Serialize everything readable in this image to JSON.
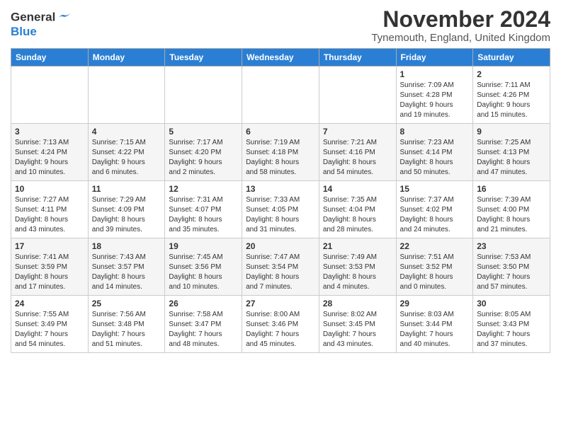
{
  "header": {
    "logo_line1": "General",
    "logo_line2": "Blue",
    "month_title": "November 2024",
    "location": "Tynemouth, England, United Kingdom"
  },
  "weekdays": [
    "Sunday",
    "Monday",
    "Tuesday",
    "Wednesday",
    "Thursday",
    "Friday",
    "Saturday"
  ],
  "weeks": [
    [
      {
        "day": "",
        "info": ""
      },
      {
        "day": "",
        "info": ""
      },
      {
        "day": "",
        "info": ""
      },
      {
        "day": "",
        "info": ""
      },
      {
        "day": "",
        "info": ""
      },
      {
        "day": "1",
        "info": "Sunrise: 7:09 AM\nSunset: 4:28 PM\nDaylight: 9 hours\nand 19 minutes."
      },
      {
        "day": "2",
        "info": "Sunrise: 7:11 AM\nSunset: 4:26 PM\nDaylight: 9 hours\nand 15 minutes."
      }
    ],
    [
      {
        "day": "3",
        "info": "Sunrise: 7:13 AM\nSunset: 4:24 PM\nDaylight: 9 hours\nand 10 minutes."
      },
      {
        "day": "4",
        "info": "Sunrise: 7:15 AM\nSunset: 4:22 PM\nDaylight: 9 hours\nand 6 minutes."
      },
      {
        "day": "5",
        "info": "Sunrise: 7:17 AM\nSunset: 4:20 PM\nDaylight: 9 hours\nand 2 minutes."
      },
      {
        "day": "6",
        "info": "Sunrise: 7:19 AM\nSunset: 4:18 PM\nDaylight: 8 hours\nand 58 minutes."
      },
      {
        "day": "7",
        "info": "Sunrise: 7:21 AM\nSunset: 4:16 PM\nDaylight: 8 hours\nand 54 minutes."
      },
      {
        "day": "8",
        "info": "Sunrise: 7:23 AM\nSunset: 4:14 PM\nDaylight: 8 hours\nand 50 minutes."
      },
      {
        "day": "9",
        "info": "Sunrise: 7:25 AM\nSunset: 4:13 PM\nDaylight: 8 hours\nand 47 minutes."
      }
    ],
    [
      {
        "day": "10",
        "info": "Sunrise: 7:27 AM\nSunset: 4:11 PM\nDaylight: 8 hours\nand 43 minutes."
      },
      {
        "day": "11",
        "info": "Sunrise: 7:29 AM\nSunset: 4:09 PM\nDaylight: 8 hours\nand 39 minutes."
      },
      {
        "day": "12",
        "info": "Sunrise: 7:31 AM\nSunset: 4:07 PM\nDaylight: 8 hours\nand 35 minutes."
      },
      {
        "day": "13",
        "info": "Sunrise: 7:33 AM\nSunset: 4:05 PM\nDaylight: 8 hours\nand 31 minutes."
      },
      {
        "day": "14",
        "info": "Sunrise: 7:35 AM\nSunset: 4:04 PM\nDaylight: 8 hours\nand 28 minutes."
      },
      {
        "day": "15",
        "info": "Sunrise: 7:37 AM\nSunset: 4:02 PM\nDaylight: 8 hours\nand 24 minutes."
      },
      {
        "day": "16",
        "info": "Sunrise: 7:39 AM\nSunset: 4:00 PM\nDaylight: 8 hours\nand 21 minutes."
      }
    ],
    [
      {
        "day": "17",
        "info": "Sunrise: 7:41 AM\nSunset: 3:59 PM\nDaylight: 8 hours\nand 17 minutes."
      },
      {
        "day": "18",
        "info": "Sunrise: 7:43 AM\nSunset: 3:57 PM\nDaylight: 8 hours\nand 14 minutes."
      },
      {
        "day": "19",
        "info": "Sunrise: 7:45 AM\nSunset: 3:56 PM\nDaylight: 8 hours\nand 10 minutes."
      },
      {
        "day": "20",
        "info": "Sunrise: 7:47 AM\nSunset: 3:54 PM\nDaylight: 8 hours\nand 7 minutes."
      },
      {
        "day": "21",
        "info": "Sunrise: 7:49 AM\nSunset: 3:53 PM\nDaylight: 8 hours\nand 4 minutes."
      },
      {
        "day": "22",
        "info": "Sunrise: 7:51 AM\nSunset: 3:52 PM\nDaylight: 8 hours\nand 0 minutes."
      },
      {
        "day": "23",
        "info": "Sunrise: 7:53 AM\nSunset: 3:50 PM\nDaylight: 7 hours\nand 57 minutes."
      }
    ],
    [
      {
        "day": "24",
        "info": "Sunrise: 7:55 AM\nSunset: 3:49 PM\nDaylight: 7 hours\nand 54 minutes."
      },
      {
        "day": "25",
        "info": "Sunrise: 7:56 AM\nSunset: 3:48 PM\nDaylight: 7 hours\nand 51 minutes."
      },
      {
        "day": "26",
        "info": "Sunrise: 7:58 AM\nSunset: 3:47 PM\nDaylight: 7 hours\nand 48 minutes."
      },
      {
        "day": "27",
        "info": "Sunrise: 8:00 AM\nSunset: 3:46 PM\nDaylight: 7 hours\nand 45 minutes."
      },
      {
        "day": "28",
        "info": "Sunrise: 8:02 AM\nSunset: 3:45 PM\nDaylight: 7 hours\nand 43 minutes."
      },
      {
        "day": "29",
        "info": "Sunrise: 8:03 AM\nSunset: 3:44 PM\nDaylight: 7 hours\nand 40 minutes."
      },
      {
        "day": "30",
        "info": "Sunrise: 8:05 AM\nSunset: 3:43 PM\nDaylight: 7 hours\nand 37 minutes."
      }
    ]
  ]
}
